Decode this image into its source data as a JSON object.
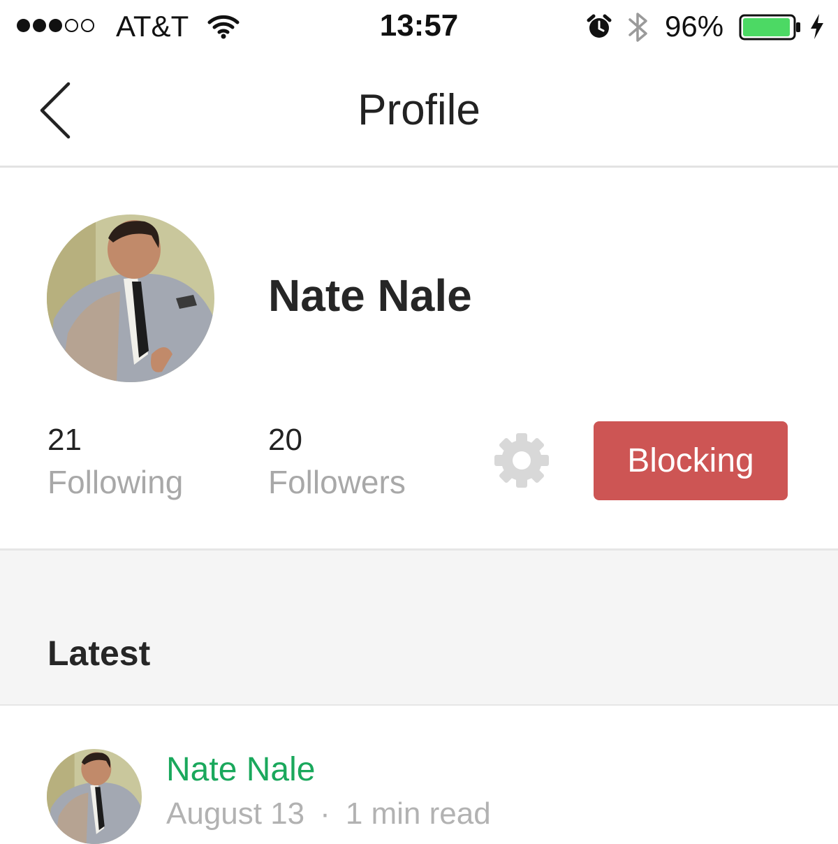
{
  "status_bar": {
    "signal_filled": 3,
    "signal_total": 5,
    "carrier": "AT&T",
    "time": "13:57",
    "battery_percent": "96%",
    "battery_level": 0.96,
    "battery_color": "#4cd964",
    "icons": [
      "wifi-icon",
      "alarm-icon",
      "bluetooth-icon",
      "battery-icon",
      "charging-bolt-icon"
    ]
  },
  "nav": {
    "title": "Profile",
    "back_icon": "chevron-left-icon"
  },
  "profile": {
    "name": "Nate Nale",
    "following_count": "21",
    "following_label": "Following",
    "followers_count": "20",
    "followers_label": "Followers",
    "settings_icon": "gear-icon",
    "block_button_label": "Blocking",
    "block_button_color": "#cd5554"
  },
  "latest": {
    "title": "Latest",
    "posts": [
      {
        "author": "Nate Nale",
        "date": "August 13",
        "separator": "·",
        "read_time": "1 min read",
        "author_color": "#1aa85c"
      }
    ]
  }
}
